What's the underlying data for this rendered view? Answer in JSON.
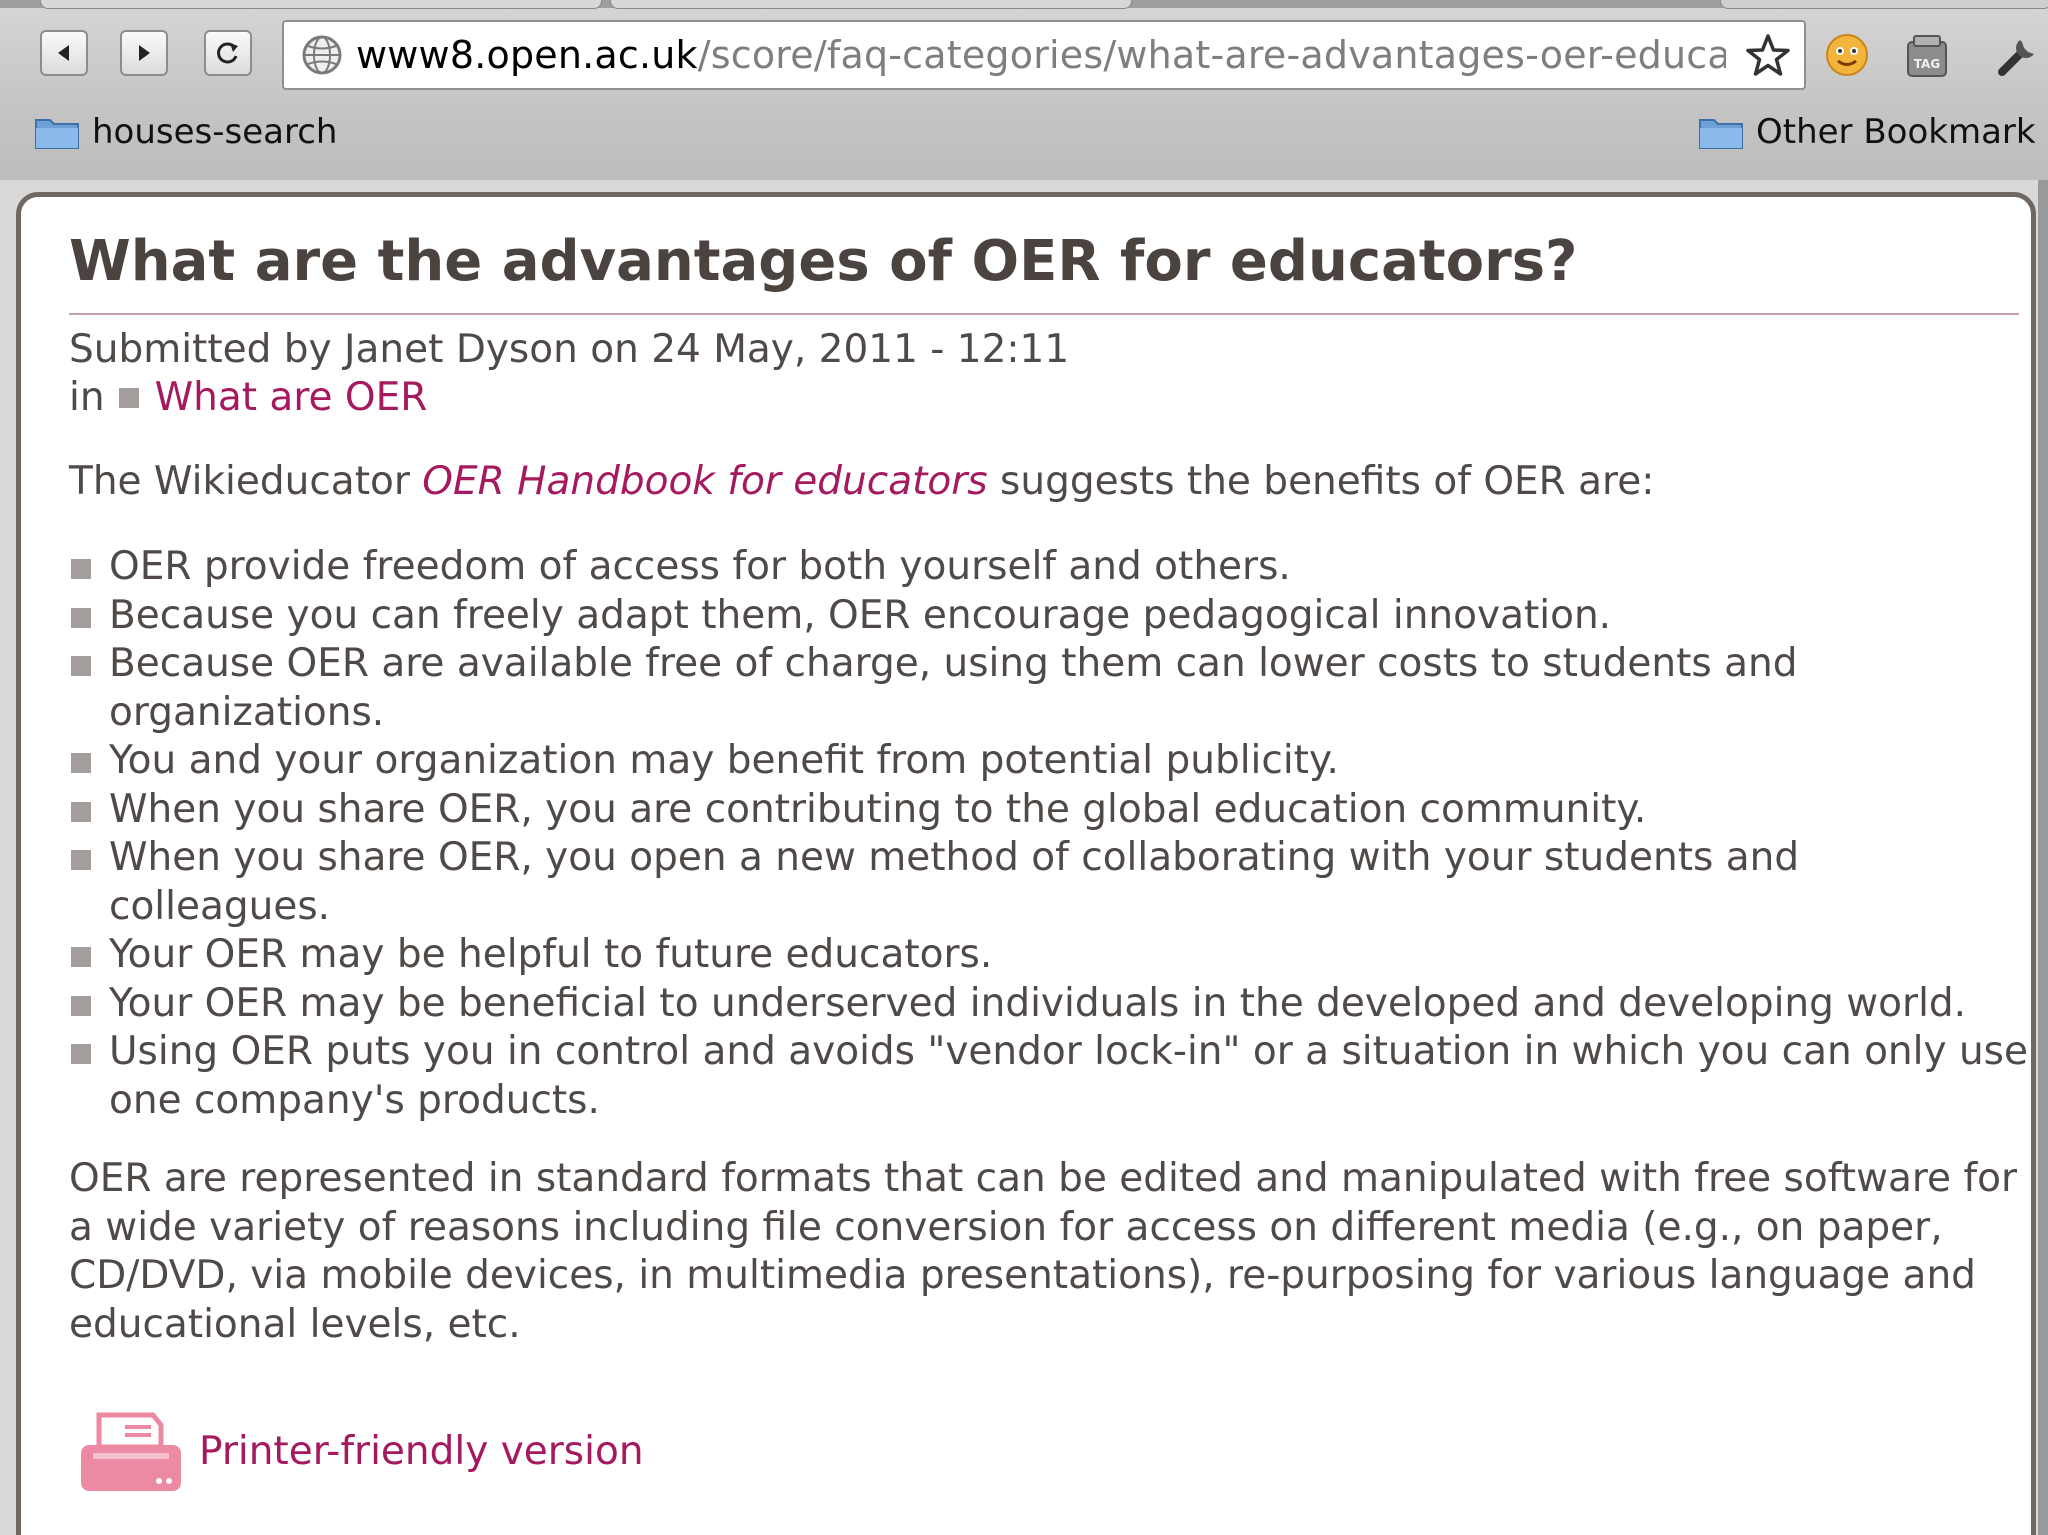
{
  "browser": {
    "url_host": "www8.open.ac.uk",
    "url_path": "/score/faq-categories/what-are-advantages-oer-educa",
    "bookmarks": [
      "houses-search",
      "Other Bookmark"
    ]
  },
  "page": {
    "title": "What are the advantages of OER for educators?",
    "submitted": "Submitted by Janet Dyson on 24 May, 2011 - 12:11",
    "category_prefix": "in",
    "category_link": "What are OER",
    "intro_before": "The Wikieducator ",
    "intro_link": "OER Handbook for educators",
    "intro_after": " suggests the benefits of OER are:",
    "benefits": [
      "OER provide freedom of access for both yourself and others.",
      "Because you can freely adapt them, OER encourage pedagogical innovation.",
      "Because OER are available free of charge, using them can lower costs to students and organizations.",
      "You and your organization may benefit from potential publicity.",
      "When you share OER, you are contributing to the global education community.",
      "When you share OER, you open a new method of collaborating with your students and colleagues.",
      "Your OER may be helpful to future educators.",
      "Your OER may be beneficial to underserved individuals in the developed and developing world.",
      "Using OER puts you in control and avoids \"vendor lock-in\" or a situation in which you can only use one company's products."
    ],
    "closing": "OER are represented in standard formats that can be edited and manipulated with free software for a wide variety of reasons including file conversion for access on different media (e.g., on paper, CD/DVD, via mobile devices, in multimedia presentations), re-purposing for various language and educational levels, etc.",
    "printer_link": "Printer-friendly version"
  },
  "colors": {
    "link": "#a5195e",
    "title": "#4a4340",
    "body_text": "#4f4a47",
    "frame_border": "#6f6862"
  },
  "icons": [
    "back-icon",
    "forward-icon",
    "reload-icon",
    "globe-icon",
    "star-icon",
    "smiley-icon",
    "tag-icon",
    "wrench-icon",
    "folder-icon",
    "printer-icon"
  ]
}
